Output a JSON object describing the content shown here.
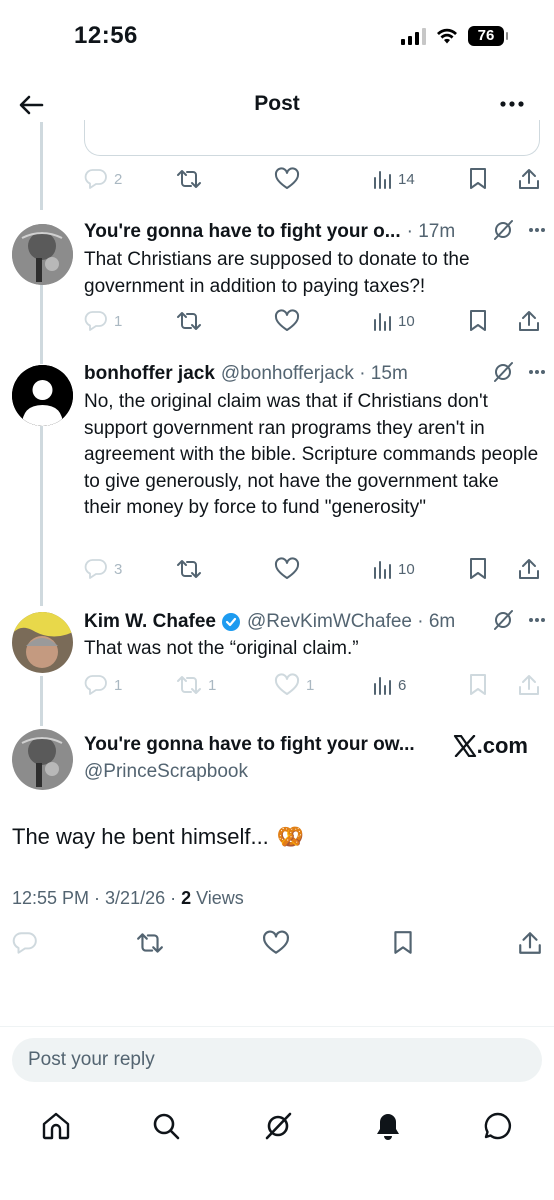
{
  "status_bar": {
    "time": "12:56",
    "battery": "76"
  },
  "header": {
    "title": "Post"
  },
  "thread": [
    {
      "stats": {
        "replies": "2",
        "views": "14"
      }
    },
    {
      "name": "You're gonna have to fight your o...",
      "meta": "· 17m",
      "text": "That Christians are supposed to donate to the government in addition to paying taxes?!",
      "stats": {
        "replies": "1",
        "views": "10"
      }
    },
    {
      "name": "bonhoffer jack",
      "meta": "@bonhofferjack · 15m",
      "text": "No, the original claim was that if Christians don't support government ran programs they aren't in agreement with the bible. Scripture commands people to give generously, not have the government take their money by force to fund \"generosity\"",
      "stats": {
        "replies": "3",
        "views": "10"
      }
    },
    {
      "name": "Kim W. Chafee",
      "meta": "@RevKimWChafee · 6m",
      "text": "That was not the “original claim.”",
      "stats": {
        "replies": "1",
        "reposts": "1",
        "likes": "1",
        "views": "6"
      }
    }
  ],
  "main_post": {
    "name": "You're gonna have to fight your ow...",
    "handle": "@PrinceScrapbook",
    "source": ".com",
    "text": "The way he bent himself...",
    "emoji": "🥨",
    "time": "12:55 PM · 3/21/26 · ",
    "views_count": "2",
    "views_label": " Views"
  },
  "reply": {
    "placeholder": "Post your reply"
  },
  "colors": {
    "text": "#0f1419",
    "secondary": "#536471",
    "border": "#cfd9de",
    "verified": "#1d9bf0"
  }
}
